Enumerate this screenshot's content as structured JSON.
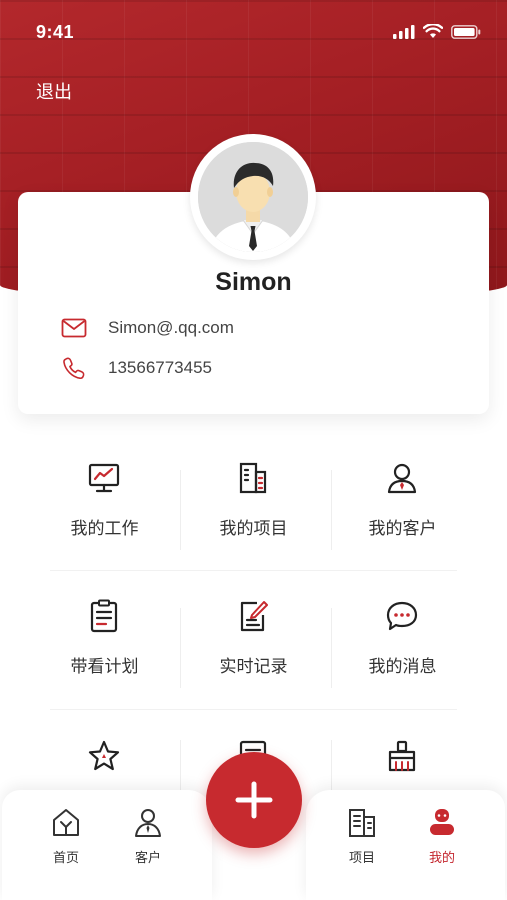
{
  "status_bar": {
    "time": "9:41"
  },
  "header": {
    "logout_label": "退出"
  },
  "profile": {
    "name": "Simon",
    "email": "Simon@.qq.com",
    "phone": "13566773455"
  },
  "menu": {
    "items": [
      {
        "label": "我的工作",
        "icon": "monitor-chart-icon"
      },
      {
        "label": "我的项目",
        "icon": "building-icon"
      },
      {
        "label": "我的客户",
        "icon": "client-person-icon"
      },
      {
        "label": "带看计划",
        "icon": "clipboard-list-icon"
      },
      {
        "label": "实时记录",
        "icon": "edit-document-icon"
      },
      {
        "label": "我的消息",
        "icon": "chat-bubble-icon"
      },
      {
        "label": "",
        "icon": "star-icon"
      },
      {
        "label": "",
        "icon": "document-icon"
      },
      {
        "label": "",
        "icon": "broom-icon"
      }
    ]
  },
  "tabbar": {
    "tabs": [
      {
        "label": "首页",
        "icon": "home-icon"
      },
      {
        "label": "客户",
        "icon": "customer-icon"
      },
      {
        "label": "项目",
        "icon": "project-building-icon"
      },
      {
        "label": "我的",
        "icon": "profile-icon",
        "active": true
      }
    ],
    "fab_icon": "plus-icon"
  },
  "colors": {
    "brand": "#c72a2f",
    "hero": "#a41f24"
  }
}
